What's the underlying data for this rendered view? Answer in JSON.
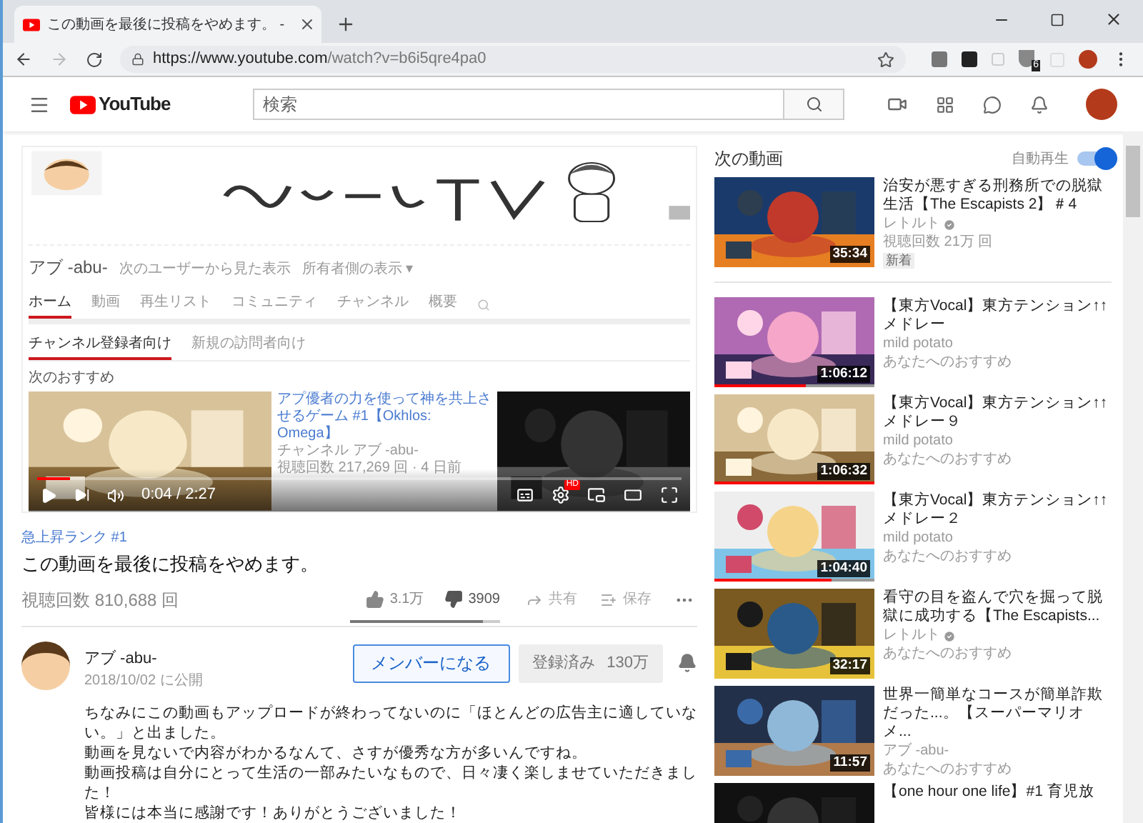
{
  "browser": {
    "tab_title": "この動画を最後に投稿をやめます。 -",
    "url_host": "https://www.youtube.com",
    "url_path": "/watch?v=b6i5qre4pa0",
    "extension_badge": "6"
  },
  "header": {
    "logo": "YouTube",
    "search_placeholder": "検索"
  },
  "player": {
    "channel_name": "アブ -abu-",
    "view_as": "次のユーザーから見た表示",
    "view_mode": "所有者側の表示 ▾",
    "tabs": [
      {
        "label": "ホーム",
        "selected": true
      },
      {
        "label": "動画",
        "selected": false
      },
      {
        "label": "再生リスト",
        "selected": false
      },
      {
        "label": "コミュニティ",
        "selected": false
      },
      {
        "label": "チャンネル",
        "selected": false
      },
      {
        "label": "概要",
        "selected": false
      }
    ],
    "subtabs": [
      {
        "label": "チャンネル登録者向け",
        "selected": true
      },
      {
        "label": "新規の訪問者向け",
        "selected": false
      }
    ],
    "section_title": "次のおすすめ",
    "featured": {
      "title": "アプ優者の力を使って神を共上させるゲーム #1【Okhlos: Omega】",
      "channel": "チャンネル アブ -abu-",
      "meta": "視聴回数 217,269 回 · 4 日前"
    },
    "time": "0:04 / 2:27",
    "hd_badge": "HD",
    "progress": {
      "level": 0.05
    }
  },
  "video": {
    "badge": "急上昇ランク #1",
    "title": "この動画を最後に投稿をやめます。",
    "views": "視聴回数 810,688 回",
    "likes": "3.1万",
    "dislikes": "3909",
    "share": "共有",
    "save": "保存",
    "rating": {
      "level": 0.89
    }
  },
  "channel": {
    "name": "アブ -abu-",
    "date": "2018/10/02 に公開",
    "member_button": "メンバーになる",
    "subscribe_button": "登録済み",
    "subscriber_count": "130万"
  },
  "description": [
    "ちなみにこの動画もアップロードが終わってないのに「ほとんどの広告主に適していない。」と出ました。",
    "動画を見ないで内容がわかるなんて、さすが優秀な方が多いんですね。",
    "動画投稿は自分にとって生活の一部みたいなもので、日々凄く楽しませていただきました！",
    "皆様には本当に感謝です！ありがとうございました！"
  ],
  "sidebar": {
    "title": "次の動画",
    "autoplay_label": "自動再生",
    "autoplay_on": true,
    "items": [
      {
        "title": "治安が悪すぎる刑務所での脱獄生活【The Escapists 2】＃4",
        "channel": "レトルト",
        "verified": true,
        "meta": "視聴回数 21万 回",
        "badge": "新着",
        "duration": "35:34"
      },
      {
        "title": "【東方Vocal】東方テンション↑↑メドレー",
        "channel": "mild potato",
        "verified": false,
        "meta": "あなたへのおすすめ",
        "duration": "1:06:12",
        "watched": {
          "level": 0.57
        }
      },
      {
        "title": "【東方Vocal】東方テンション↑↑メドレー９",
        "channel": "mild potato",
        "verified": false,
        "meta": "あなたへのおすすめ",
        "duration": "1:06:32",
        "watched": {
          "level": 1
        }
      },
      {
        "title": "【東方Vocal】東方テンション↑↑メドレー２",
        "channel": "mild potato",
        "verified": false,
        "meta": "あなたへのおすすめ",
        "duration": "1:04:40",
        "watched": {
          "level": 0.73
        }
      },
      {
        "title": "看守の目を盗んで穴を掘って脱獄に成功する【The Escapists...",
        "channel": "レトルト",
        "verified": true,
        "meta": "あなたへのおすすめ",
        "duration": "32:17"
      },
      {
        "title": "世界一簡単なコースが簡単詐欺だった...。【スーパーマリオメ...",
        "channel": "アブ -abu-",
        "verified": false,
        "meta": "あなたへのおすすめ",
        "duration": "11:57"
      },
      {
        "title": "【one hour one life】#1 育児放"
      }
    ]
  }
}
